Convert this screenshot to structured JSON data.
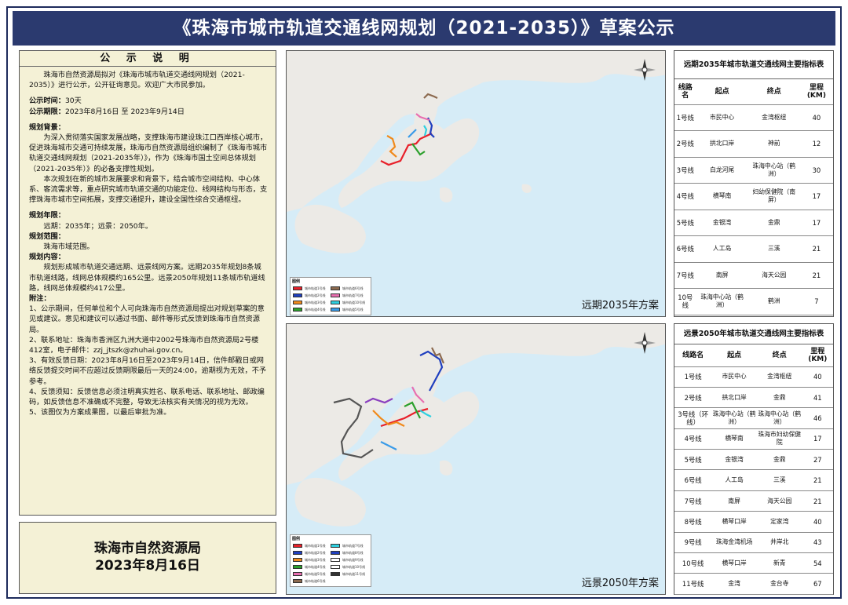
{
  "title": "《珠海市城市轨道交通线网规划（2021-2035）》草案公示",
  "notice": {
    "heading": "公 示 说 明",
    "intro": "珠海市自然资源局拟对《珠海市城市轨道交通线网规划（2021-2035）》进行公示，公开征询意见。欢迎广大市民参加。",
    "period_label": "公示时间：",
    "period": "30天",
    "dates_label": "公示期限：",
    "dates": "2023年8月16日 至 2023年9月14日",
    "background_label": "规划背景：",
    "background_1": "为深入贯彻落实国家发展战略，支撑珠海市建设珠江口西岸核心城市，促进珠海城市交通可持续发展，珠海市自然资源局组织编制了《珠海市城市轨道交通线网规划（2021-2035年）》，作为《珠海市国土空间总体规划（2021-2035年）》的必备支撑性规划。",
    "background_2": "本次规划在新的城市发展要求和背景下，结合城市空间结构、中心体系、客流需求等，重点研究城市轨道交通的功能定位、线网结构与形态，支撑珠海市城市空间拓展，支撑交通提升，建设全国性综合交通枢纽。",
    "years_label": "规划年限：",
    "years": "远期：2035年；远景：2050年。",
    "scope_label": "规划范围：",
    "scope": "珠海市域范围。",
    "content_label": "规划内容：",
    "content": "规划形成城市轨道交通远期、远景线网方案。远期2035年规划8条城市轨道线路，线网总体规模约165公里。远景2050年规划11条城市轨道线路，线网总体规模约417公里。",
    "notes_label": "附注：",
    "note_1": "1、公示期间，任何单位和个人可向珠海市自然资源局提出对规划草案的意见或建议。意见和建议可以通过书面、邮件等形式反馈到珠海市自然资源局。",
    "note_2": "2、联系地址：珠海市香洲区九洲大道中2002号珠海市自然资源局2号楼412室，电子邮件：zzj_jtszk@zhuhai.gov.cn。",
    "note_3": "3、有效反馈日期：2023年8月16日至2023年9月14日，信件邮戳日或网络反馈提交时间不应超过反馈期限最后一天的24:00，逾期视为无效，不予参考。",
    "note_4": "4、反馈须知：反馈信息必须注明真实姓名、联系电话、联系地址、邮政编码，如反馈信息不准确或不完整，导致无法核实有关情况的视为无效。",
    "note_5": "5、该图仅为方案成果图，以最后审批为准。"
  },
  "sign": {
    "org": "珠海市自然资源局",
    "date": "2023年8月16日"
  },
  "map_2035": {
    "caption": "远期2035年方案",
    "legend_title": "图例",
    "legend": [
      {
        "label": "城市轨道1号线",
        "color": "#e8202a"
      },
      {
        "label": "城市轨道6号线",
        "color": "#8c6a4f"
      },
      {
        "label": "城市轨道2号线",
        "color": "#1f3fbf"
      },
      {
        "label": "城市轨道7号线",
        "color": "#e86fb0"
      },
      {
        "label": "城市轨道3号线",
        "color": "#f08a1c"
      },
      {
        "label": "城市轨道10号线",
        "color": "#2fd0e0"
      },
      {
        "label": "城市轨道4号线",
        "color": "#2ca02c"
      },
      {
        "label": "城市轨道5号线",
        "color": "#3a9be8"
      }
    ]
  },
  "map_2050": {
    "caption": "远景2050年方案",
    "legend_title": "图例",
    "legend": [
      {
        "label": "城市轨道1号线",
        "color": "#e8202a"
      },
      {
        "label": "城市轨道7号线",
        "color": "#2fd0e0"
      },
      {
        "label": "城市轨道2号线",
        "color": "#1f3fbf"
      },
      {
        "label": "城市轨道8号线",
        "color": "#1f3fbf"
      },
      {
        "label": "城市轨道3号线",
        "color": "#f08a1c"
      },
      {
        "label": "城市轨道9号线",
        "color": "#ffffff"
      },
      {
        "label": "城市轨道4号线",
        "color": "#2ca02c"
      },
      {
        "label": "城市轨道10号线",
        "color": "#ffffff"
      },
      {
        "label": "城市轨道5号线",
        "color": "#e86fb0"
      },
      {
        "label": "城市轨道11号线",
        "color": "#333333"
      },
      {
        "label": "城市轨道6号线",
        "color": "#8c6a4f"
      }
    ]
  },
  "table_2035": {
    "title": "远期2035年城市轨道交通线网主要指标表",
    "headers": [
      "线路名",
      "起点",
      "终点",
      "里程(KM)"
    ],
    "rows": [
      [
        "1号线",
        "市民中心",
        "金湾枢纽",
        "40"
      ],
      [
        "2号线",
        "拱北口岸",
        "神前",
        "12"
      ],
      [
        "3号线",
        "白龙河尾",
        "珠海中心站（鹤洲）",
        "30"
      ],
      [
        "4号线",
        "横琴南",
        "妇幼保健院（南屏）",
        "17"
      ],
      [
        "5号线",
        "金银湾",
        "金鼎",
        "17"
      ],
      [
        "6号线",
        "人工岛",
        "三溪",
        "21"
      ],
      [
        "7号线",
        "南屏",
        "海天公园",
        "21"
      ],
      [
        "10号线",
        "珠海中心站（鹤洲）",
        "鹤洲",
        "7"
      ]
    ]
  },
  "table_2050": {
    "title": "远景2050年城市轨道交通线网主要指标表",
    "headers": [
      "线路名",
      "起点",
      "终点",
      "里程(KM)"
    ],
    "rows": [
      [
        "1号线",
        "市民中心",
        "金湾枢纽",
        "40"
      ],
      [
        "2号线",
        "拱北口岸",
        "金鼎",
        "41"
      ],
      [
        "3号线（环线）",
        "珠海中心站（鹤洲）",
        "珠海中心站（鹤洲）",
        "46"
      ],
      [
        "4号线",
        "横琴南",
        "珠海市妇幼保健院",
        "17"
      ],
      [
        "5号线",
        "金银湾",
        "金鼎",
        "27"
      ],
      [
        "6号线",
        "人工岛",
        "三溪",
        "21"
      ],
      [
        "7号线",
        "南屏",
        "海天公园",
        "21"
      ],
      [
        "8号线",
        "横琴口岸",
        "定家湾",
        "40"
      ],
      [
        "9号线",
        "珠海金湾机场",
        "井岸北",
        "43"
      ],
      [
        "10号线",
        "横琴口岸",
        "新青",
        "54"
      ],
      [
        "11号线",
        "金湾",
        "金台寺",
        "67"
      ]
    ]
  }
}
